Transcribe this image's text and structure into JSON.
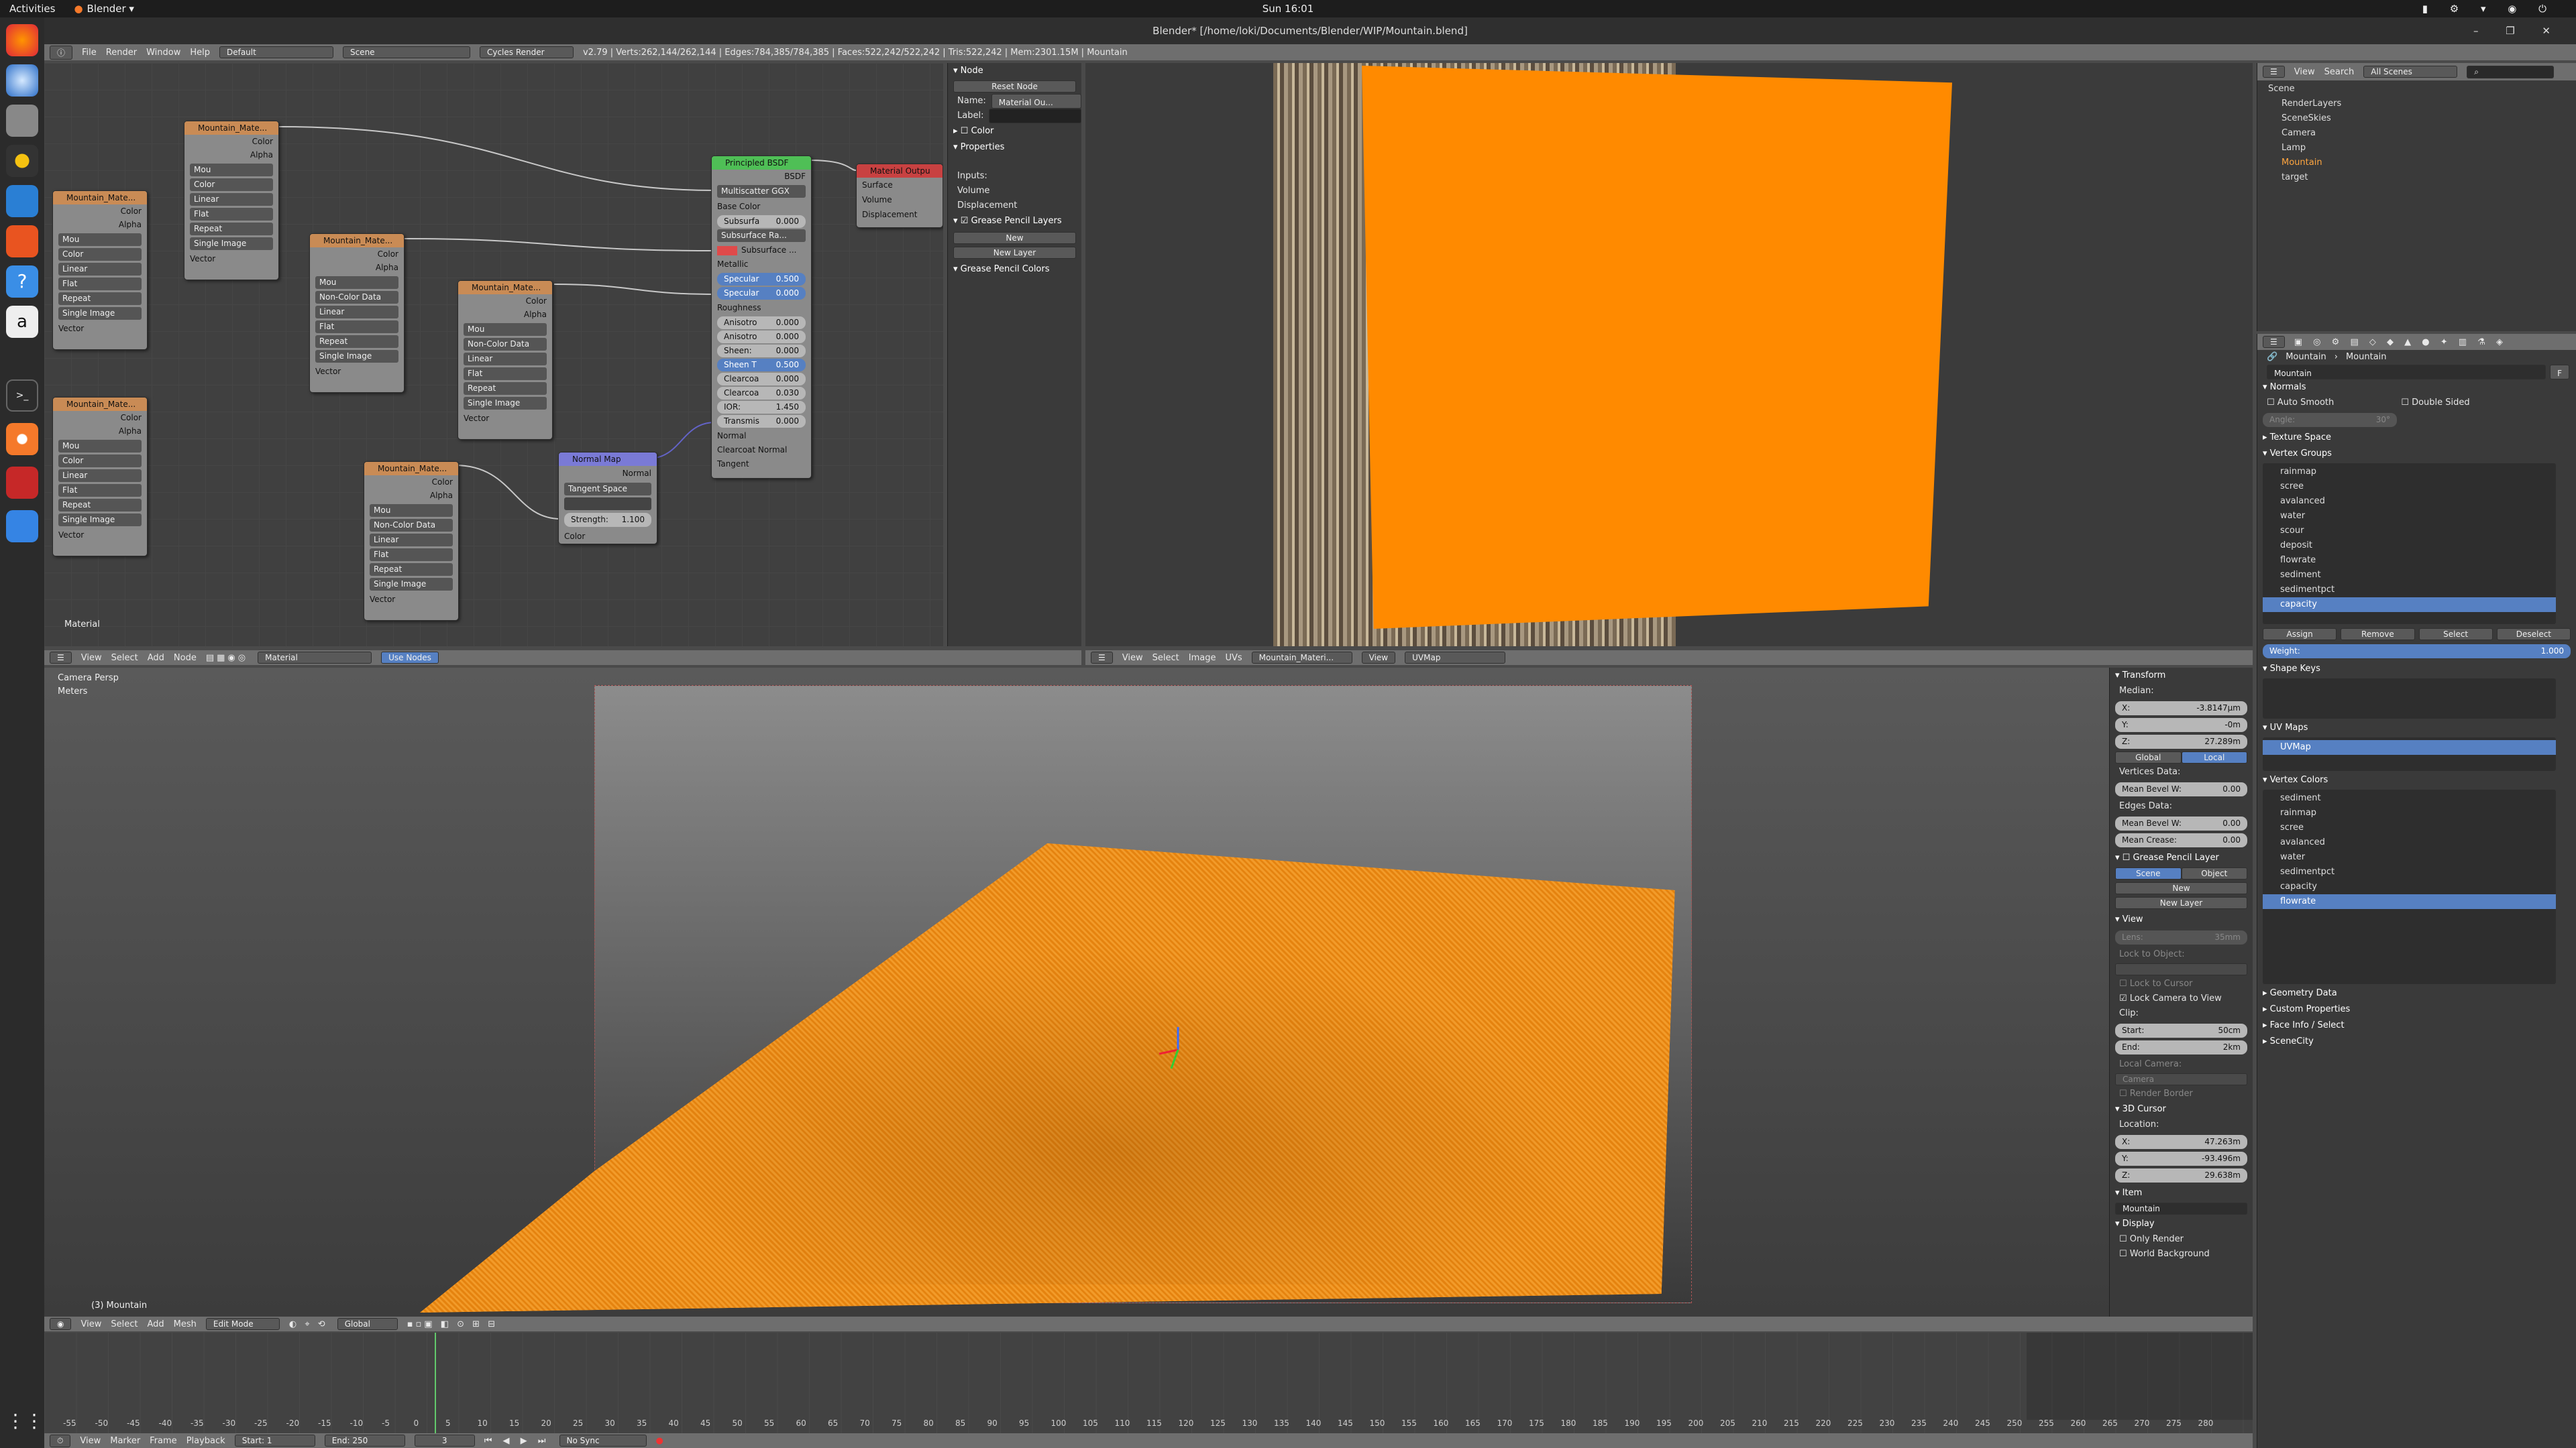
{
  "os": {
    "activities": "Activities",
    "app_name": "Blender",
    "clock": "Sun 16:01"
  },
  "window": {
    "title": "Blender* [/home/loki/Documents/Blender/WIP/Mountain.blend]"
  },
  "info_header": {
    "menus": [
      "File",
      "Render",
      "Window",
      "Help"
    ],
    "layout": "Default",
    "scene": "Scene",
    "engine": "Cycles Render",
    "stats": "v2.79 | Verts:262,144/262,144 | Edges:784,385/784,385 | Faces:522,242/522,242 | Tris:522,242 | Mem:2301.15M | Mountain"
  },
  "node_editor": {
    "nodes": {
      "tex_a": {
        "title": "Mountain_Mate...",
        "out1": "Color",
        "out2": "Alpha",
        "img": "Mou",
        "d1": "Color",
        "d2": "Linear",
        "d3": "Flat",
        "d4": "Repeat",
        "d5": "Single Image",
        "vec": "Vector"
      },
      "tex_b": {
        "title": "Mountain_Mate...",
        "out1": "Color",
        "out2": "Alpha",
        "img": "Mou",
        "d1": "Color",
        "d2": "Linear",
        "d3": "Flat",
        "d4": "Repeat",
        "d5": "Single Image",
        "vec": "Vector"
      },
      "tex_c": {
        "title": "Mountain_Mate...",
        "out1": "Color",
        "out2": "Alpha",
        "img": "Mou",
        "d1": "Color",
        "d2": "Linear",
        "d3": "Flat",
        "d4": "Repeat",
        "d5": "Single Image",
        "vec": "Vector"
      },
      "tex_d": {
        "title": "Mountain_Mate...",
        "out1": "Color",
        "out2": "Alpha",
        "img": "Mou",
        "d1": "Non-Color Data",
        "d2": "Linear",
        "d3": "Flat",
        "d4": "Repeat",
        "d5": "Single Image",
        "vec": "Vector"
      },
      "tex_e": {
        "title": "Mountain_Mate...",
        "out1": "Color",
        "out2": "Alpha",
        "img": "Mou",
        "d1": "Non-Color Data",
        "d2": "Linear",
        "d3": "Flat",
        "d4": "Repeat",
        "d5": "Single Image",
        "vec": "Vector"
      },
      "tex_f": {
        "title": "Mountain_Mate...",
        "out1": "Color",
        "out2": "Alpha",
        "img": "Mou",
        "d1": "Non-Color Data",
        "d2": "Linear",
        "d3": "Flat",
        "d4": "Repeat",
        "d5": "Single Image",
        "vec": "Vector"
      },
      "bsdf": {
        "title": "Principled BSDF",
        "out": "BSDF",
        "dist": "Multiscatter GGX",
        "rows": [
          {
            "label": "Base Color",
            "type": "text"
          },
          {
            "label": "Subsurfa",
            "value": "0.000",
            "type": "field"
          },
          {
            "label": "Subsurface Ra...",
            "type": "dd"
          },
          {
            "label": "Subsurface ...",
            "type": "color"
          },
          {
            "label": "Metallic",
            "type": "text"
          },
          {
            "label": "Specular",
            "value": "0.500",
            "type": "field"
          },
          {
            "label": "Specular",
            "value": "0.000",
            "type": "field"
          },
          {
            "label": "Roughness",
            "type": "text"
          },
          {
            "label": "Anisotro",
            "value": "0.000",
            "type": "field"
          },
          {
            "label": "Anisotro",
            "value": "0.000",
            "type": "field"
          },
          {
            "label": "Sheen:",
            "value": "0.000",
            "type": "field"
          },
          {
            "label": "Sheen T",
            "value": "0.500",
            "type": "field"
          },
          {
            "label": "Clearcoa",
            "value": "0.000",
            "type": "field"
          },
          {
            "label": "Clearcoa",
            "value": "0.030",
            "type": "field"
          },
          {
            "label": "IOR:",
            "value": "1.450",
            "type": "field"
          },
          {
            "label": "Transmis",
            "value": "0.000",
            "type": "field"
          },
          {
            "label": "Normal",
            "type": "text"
          },
          {
            "label": "Clearcoat Normal",
            "type": "text"
          },
          {
            "label": "Tangent",
            "type": "text"
          }
        ]
      },
      "output": {
        "title": "Material Outpu",
        "in1": "Surface",
        "in2": "Volume",
        "in3": "Displacement"
      },
      "normal_map": {
        "title": "Normal Map",
        "out": "Normal",
        "space": "Tangent Space",
        "strength_label": "Strength:",
        "strength": "1.100",
        "in": "Color"
      }
    },
    "material_label": "Material",
    "header": {
      "menus": [
        "View",
        "Select",
        "Add",
        "Node"
      ],
      "material": "Material",
      "use_nodes": "Use Nodes"
    }
  },
  "node_sidebar": {
    "node_title": "Node",
    "reset": "Reset Node",
    "name_label": "Name:",
    "name_value": "Material Ou...",
    "label_label": "Label:",
    "color_title": "Color",
    "properties_title": "Properties",
    "inputs_label": "Inputs:",
    "inputs": [
      "Volume",
      "Displacement"
    ],
    "gp_layers": "Grease Pencil Layers",
    "gp_new": "New",
    "gp_new_layer": "New Layer",
    "gp_colors": "Grease Pencil Colors"
  },
  "image_editor": {
    "header": {
      "menus": [
        "View",
        "Select",
        "Image",
        "UVs"
      ],
      "image": "Mountain_Materi...",
      "view": "View",
      "uvmap": "UVMap"
    }
  },
  "outliner": {
    "header": {
      "view": "View",
      "search": "Search",
      "scope": "All Scenes"
    },
    "items": [
      "Scene",
      "RenderLayers",
      "SceneSkies",
      "Camera",
      "Lamp",
      "Mountain",
      "target"
    ]
  },
  "properties": {
    "breadcrumb": [
      "Mountain",
      "Mountain"
    ],
    "mesh_name": "Mountain",
    "mesh_f": "F",
    "normals": {
      "title": "Normals",
      "auto_smooth": "Auto Smooth",
      "double_sided": "Double Sided",
      "angle": "Angle:",
      "angle_val": "30°"
    },
    "texture_space": "Texture Space",
    "vertex_groups": {
      "title": "Vertex Groups",
      "items": [
        "rainmap",
        "scree",
        "avalanced",
        "water",
        "scour",
        "deposit",
        "flowrate",
        "sediment",
        "sedimentpct",
        "capacity"
      ],
      "selected_index": 9,
      "assign": "Assign",
      "remove": "Remove",
      "select": "Select",
      "deselect": "Deselect",
      "weight_label": "Weight:",
      "weight": "1.000"
    },
    "shape_keys": "Shape Keys",
    "uv_maps": {
      "title": "UV Maps",
      "items": [
        "UVMap"
      ]
    },
    "vertex_colors": {
      "title": "Vertex Colors",
      "items": [
        "sediment",
        "rainmap",
        "scree",
        "avalanced",
        "water",
        "sedimentpct",
        "capacity",
        "flowrate"
      ],
      "selected_index": 7
    },
    "closed": [
      "Geometry Data",
      "Custom Properties",
      "Face Info / Select",
      "SceneCity"
    ]
  },
  "viewport": {
    "label1": "Camera Persp",
    "label2": "Meters",
    "object_label": "(3) Mountain",
    "header": {
      "menus": [
        "View",
        "Select",
        "Add",
        "Mesh"
      ],
      "mode": "Edit Mode",
      "orientation": "Global"
    }
  },
  "n_panel": {
    "transform": "Transform",
    "median": "Median:",
    "x": "X:",
    "x_val": "-3.8147μm",
    "y": "Y:",
    "y_val": "-0m",
    "z": "Z:",
    "z_val": "27.289m",
    "global": "Global",
    "local": "Local",
    "vertices_data": "Vertices Data:",
    "bevel_w": "Mean Bevel W:",
    "bevel_w_val": "0.00",
    "edges_data": "Edges Data:",
    "bevel_w2": "Mean Bevel W:",
    "bevel_w2_val": "0.00",
    "crease": "Mean Crease:",
    "crease_val": "0.00",
    "gp_layer": "Grease Pencil Layer",
    "scene": "Scene",
    "object": "Object",
    "gp_new": "New",
    "gp_new_layer": "New Layer",
    "view": "View",
    "lens": "Lens:",
    "lens_val": "35mm",
    "lock_to_object": "Lock to Object:",
    "lock_to_cursor": "Lock to Cursor",
    "lock_camera": "Lock Camera to View",
    "clip": "Clip:",
    "start": "Start:",
    "start_val": "50cm",
    "end": "End:",
    "end_val": "2km",
    "local_camera": "Local Camera:",
    "camera_val": "Camera",
    "render_border": "Render Border",
    "cursor": "3D Cursor",
    "location": "Location:",
    "cx": "X:",
    "cx_val": "47.263m",
    "cy": "Y:",
    "cy_val": "-93.496m",
    "cz": "Z:",
    "cz_val": "29.638m",
    "item": "Item",
    "item_name": "Mountain",
    "display": "Display",
    "only_render": "Only Render",
    "world_bg": "World Background"
  },
  "timeline": {
    "ticks": [
      "-55",
      "-50",
      "-45",
      "-40",
      "-35",
      "-30",
      "-25",
      "-20",
      "-15",
      "-10",
      "-5",
      "0",
      "5",
      "10",
      "15",
      "20",
      "25",
      "30",
      "35",
      "40",
      "45",
      "50",
      "55",
      "60",
      "65",
      "70",
      "75",
      "80",
      "85",
      "90",
      "95",
      "100",
      "105",
      "110",
      "115",
      "120",
      "125",
      "130",
      "135",
      "140",
      "145",
      "150",
      "155",
      "160",
      "165",
      "170",
      "175",
      "180",
      "185",
      "190",
      "195",
      "200",
      "205",
      "210",
      "215",
      "220",
      "225",
      "230",
      "235",
      "240",
      "245",
      "250",
      "255",
      "260",
      "265",
      "270",
      "275",
      "280"
    ],
    "header": {
      "menus": [
        "View",
        "Marker",
        "Frame",
        "Playback"
      ],
      "start_label": "Start:",
      "start": "1",
      "end_label": "End:",
      "end": "250",
      "frame": "3",
      "sync": "No Sync"
    }
  },
  "colors": {
    "orange": "#ff8a00",
    "selected": "#5680c2"
  }
}
